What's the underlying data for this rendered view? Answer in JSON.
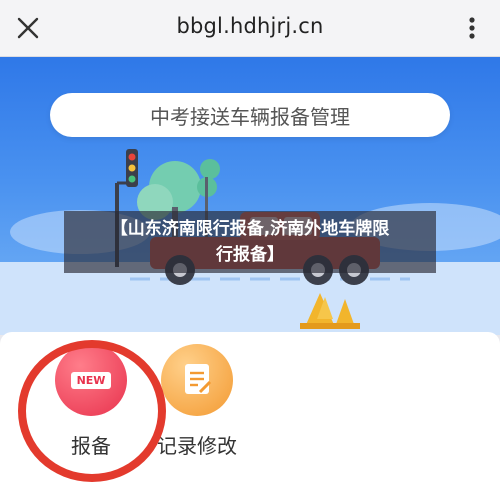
{
  "browser": {
    "url": "bbgl.hdhjrj.cn",
    "icons": {
      "close": "close-icon",
      "menu": "more-vertical-icon"
    }
  },
  "hero": {
    "title": "中考接送车辆报备管理",
    "overlay_line1": "【山东济南限行报备,济南外地车牌限",
    "overlay_line2": "行报备】"
  },
  "actions": [
    {
      "label": "报备",
      "badge": "NEW",
      "color": "#e8324d",
      "icon": "new-badge-icon"
    },
    {
      "label": "记录修改",
      "color": "#f39a32",
      "icon": "document-edit-icon"
    }
  ],
  "colors": {
    "hero_top": "#2f78e8",
    "hero_bottom": "#7ab6f6",
    "highlight_ring": "#e33a2d"
  }
}
